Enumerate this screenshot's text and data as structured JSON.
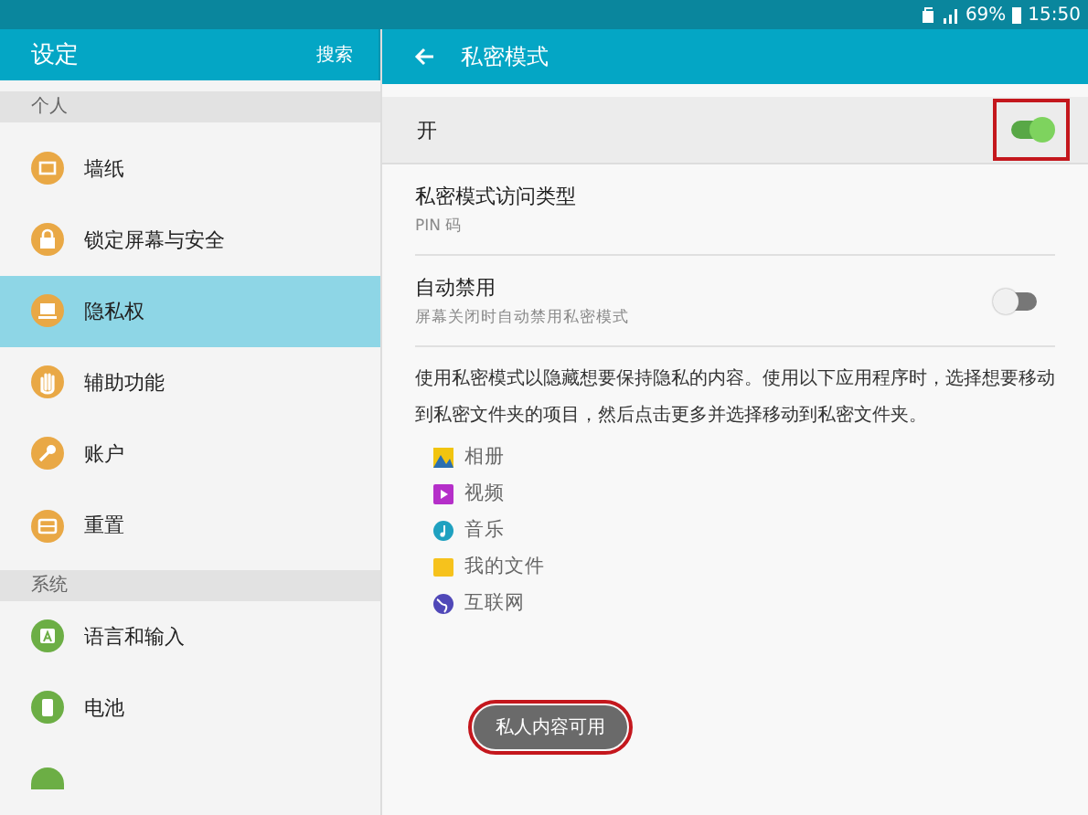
{
  "status_bar": {
    "battery": "69%",
    "time": "15:50"
  },
  "sidebar": {
    "title": "设定",
    "search": "搜索",
    "sections": [
      {
        "header": "个人",
        "items": [
          {
            "label": "墙纸",
            "kind": "wallpaper",
            "color": "#e9a845",
            "selected": false
          },
          {
            "label": "锁定屏幕与安全",
            "kind": "lock",
            "color": "#e9a845",
            "selected": false
          },
          {
            "label": "隐私权",
            "kind": "privacy",
            "color": "#e9a845",
            "selected": true
          },
          {
            "label": "辅助功能",
            "kind": "accessibility",
            "color": "#e9a845",
            "selected": false
          },
          {
            "label": "账户",
            "kind": "accounts",
            "color": "#e9a845",
            "selected": false
          },
          {
            "label": "重置",
            "kind": "reset",
            "color": "#e9a845",
            "selected": false
          }
        ]
      },
      {
        "header": "系统",
        "items": [
          {
            "label": "语言和输入",
            "kind": "language",
            "color": "#6cae45",
            "selected": false
          },
          {
            "label": "电池",
            "kind": "battery",
            "color": "#6cae45",
            "selected": false
          }
        ]
      }
    ]
  },
  "panel": {
    "title": "私密模式",
    "master": {
      "label": "开",
      "on": true,
      "highlighted": true
    },
    "settings": [
      {
        "kind": "text",
        "title": "私密模式访问类型",
        "subtitle": "PIN 码"
      },
      {
        "kind": "switch",
        "title": "自动禁用",
        "subtitle": "屏幕关闭时自动禁用私密模式",
        "on": false
      }
    ],
    "description": "使用私密模式以隐藏想要保持隐私的内容。使用以下应用程序时，选择想要移动到私密文件夹的项目，然后点击更多并选择移动到私密文件夹。",
    "apps": [
      {
        "label": "相册",
        "kind": "gallery"
      },
      {
        "label": "视频",
        "kind": "video"
      },
      {
        "label": "音乐",
        "kind": "music"
      },
      {
        "label": "我的文件",
        "kind": "files"
      },
      {
        "label": "互联网",
        "kind": "internet"
      }
    ],
    "toast": {
      "text": "私人内容可用",
      "highlighted": true
    }
  }
}
